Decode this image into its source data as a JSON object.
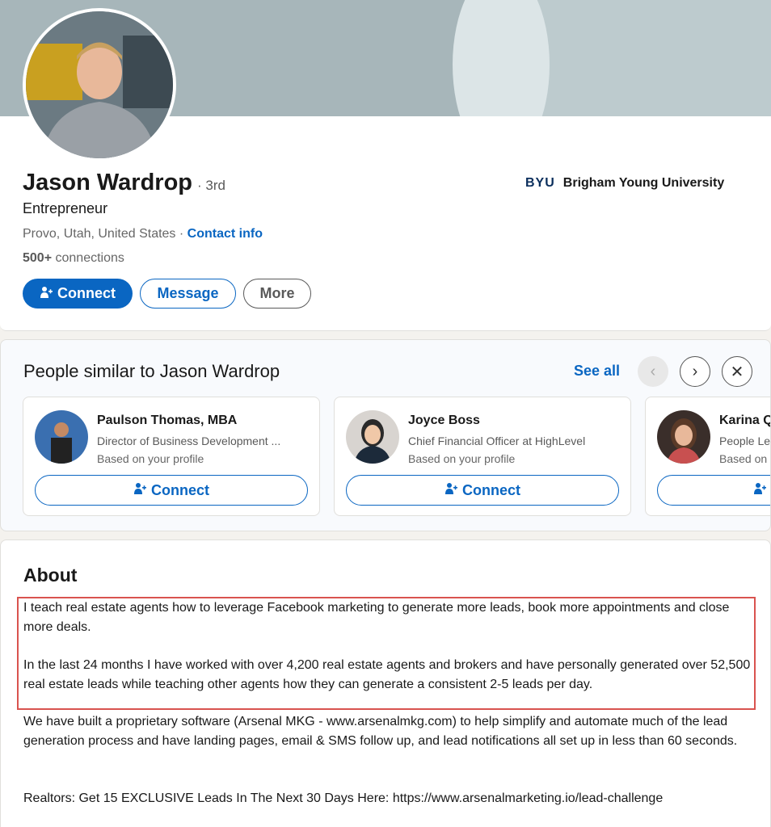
{
  "profile": {
    "name": "Jason Wardrop",
    "degree": "· 3rd",
    "headline": "Entrepreneur",
    "location": "Provo, Utah, United States",
    "separator": " · ",
    "contact_label": "Contact info",
    "connections_count": "500+",
    "connections_label": " connections",
    "education_logo": "BYU",
    "education_name": "Brigham Young University",
    "buttons": {
      "connect": "Connect",
      "message": "Message",
      "more": "More"
    }
  },
  "similar": {
    "title": "People similar to Jason Wardrop",
    "see_all": "See all",
    "people": [
      {
        "name": "Paulson Thomas, MBA",
        "title": "Director of Business Development ...",
        "basis": "Based on your profile",
        "action": "Connect"
      },
      {
        "name": "Joyce Boss",
        "title": "Chief Financial Officer at HighLevel",
        "basis": "Based on your profile",
        "action": "Connect"
      },
      {
        "name": "Karina Q",
        "title": "People Le",
        "basis": "Based on",
        "action": ""
      }
    ]
  },
  "about": {
    "title": "About",
    "paragraphs": [
      "I teach real estate agents how to leverage Facebook marketing to generate more leads, book more appointments and close more deals.",
      "In the last 24 months I have worked with over 4,200 real estate agents and brokers and have personally generated over 52,500 real estate leads while teaching other agents how they can generate a consistent 2-5 leads per day.",
      "We have built a proprietary software (Arsenal MKG - www.arsenalmkg.com) to help simplify and automate much of the lead generation process and have landing pages, email & SMS follow up, and lead notifications all set up in less than 60 seconds.",
      "Realtors: Get 15 EXCLUSIVE Leads In The Next 30 Days Here: https://www.arsenalmarketing.io/lead-challenge"
    ]
  },
  "colors": {
    "brand_blue": "#0a66c2",
    "highlight_red": "#d9534f",
    "banner": "#a7b6ba"
  },
  "icons": [
    "add-person-icon",
    "chevron-left-icon",
    "chevron-right-icon",
    "close-icon"
  ]
}
